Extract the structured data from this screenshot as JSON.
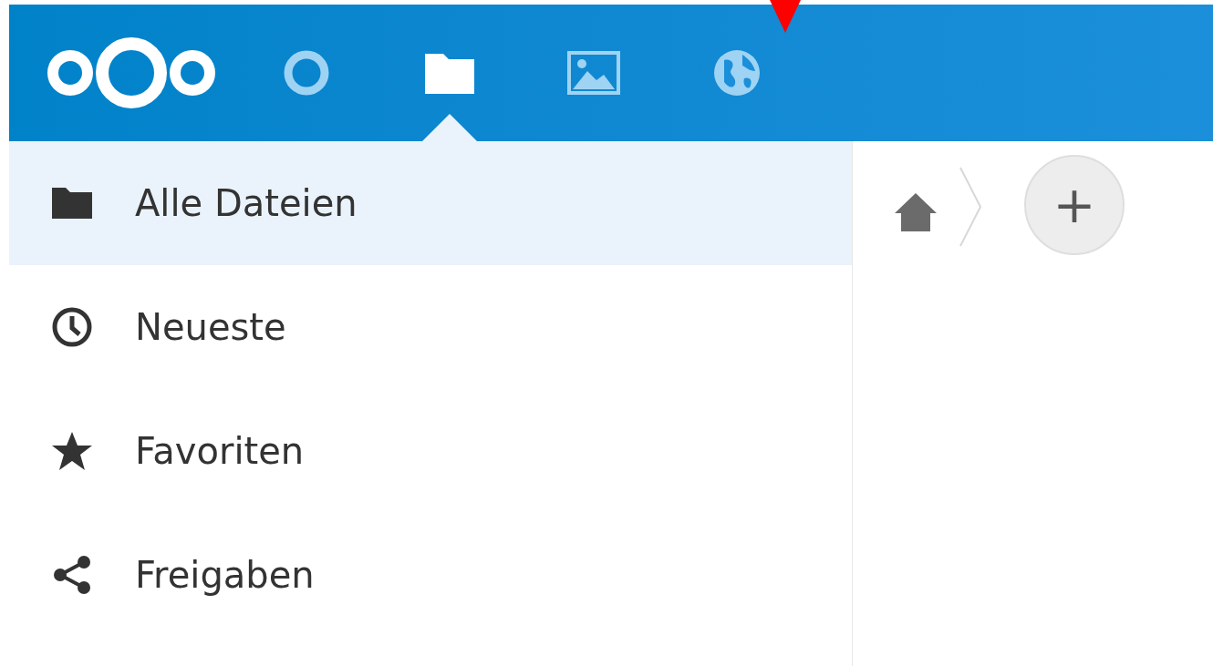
{
  "header": {
    "apps": [
      {
        "kind": "circle",
        "selected": false
      },
      {
        "kind": "folder",
        "selected": true
      },
      {
        "kind": "image",
        "selected": false
      },
      {
        "kind": "globe",
        "selected": false
      }
    ]
  },
  "sidebar": {
    "items": [
      {
        "kind": "folder",
        "label": "Alle Dateien",
        "selected": true
      },
      {
        "kind": "clock",
        "label": "Neueste",
        "selected": false
      },
      {
        "kind": "star",
        "label": "Favoriten",
        "selected": false
      },
      {
        "kind": "share",
        "label": "Freigaben",
        "selected": false
      }
    ]
  },
  "breadcrumb": {
    "add_button": "+"
  }
}
